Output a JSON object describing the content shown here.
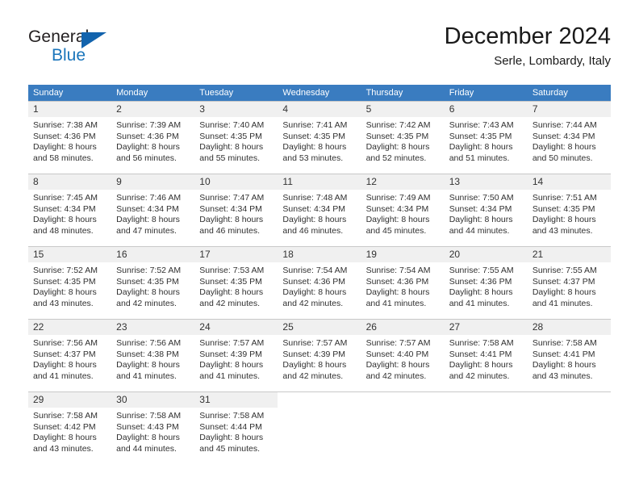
{
  "brand": {
    "name_part1": "General",
    "name_part2": "Blue",
    "triangle_color": "#1263ad",
    "blue_color": "#1a75bb"
  },
  "header": {
    "title": "December 2024",
    "subtitle": "Serle, Lombardy, Italy"
  },
  "calendar": {
    "header_bg": "#3a7cc0",
    "day_number_bg": "#f0f0f0",
    "weekdays": [
      "Sunday",
      "Monday",
      "Tuesday",
      "Wednesday",
      "Thursday",
      "Friday",
      "Saturday"
    ],
    "weeks": [
      [
        {
          "date": "1",
          "sunrise": "Sunrise: 7:38 AM",
          "sunset": "Sunset: 4:36 PM",
          "daylight_1": "Daylight: 8 hours",
          "daylight_2": "and 58 minutes."
        },
        {
          "date": "2",
          "sunrise": "Sunrise: 7:39 AM",
          "sunset": "Sunset: 4:36 PM",
          "daylight_1": "Daylight: 8 hours",
          "daylight_2": "and 56 minutes."
        },
        {
          "date": "3",
          "sunrise": "Sunrise: 7:40 AM",
          "sunset": "Sunset: 4:35 PM",
          "daylight_1": "Daylight: 8 hours",
          "daylight_2": "and 55 minutes."
        },
        {
          "date": "4",
          "sunrise": "Sunrise: 7:41 AM",
          "sunset": "Sunset: 4:35 PM",
          "daylight_1": "Daylight: 8 hours",
          "daylight_2": "and 53 minutes."
        },
        {
          "date": "5",
          "sunrise": "Sunrise: 7:42 AM",
          "sunset": "Sunset: 4:35 PM",
          "daylight_1": "Daylight: 8 hours",
          "daylight_2": "and 52 minutes."
        },
        {
          "date": "6",
          "sunrise": "Sunrise: 7:43 AM",
          "sunset": "Sunset: 4:35 PM",
          "daylight_1": "Daylight: 8 hours",
          "daylight_2": "and 51 minutes."
        },
        {
          "date": "7",
          "sunrise": "Sunrise: 7:44 AM",
          "sunset": "Sunset: 4:34 PM",
          "daylight_1": "Daylight: 8 hours",
          "daylight_2": "and 50 minutes."
        }
      ],
      [
        {
          "date": "8",
          "sunrise": "Sunrise: 7:45 AM",
          "sunset": "Sunset: 4:34 PM",
          "daylight_1": "Daylight: 8 hours",
          "daylight_2": "and 48 minutes."
        },
        {
          "date": "9",
          "sunrise": "Sunrise: 7:46 AM",
          "sunset": "Sunset: 4:34 PM",
          "daylight_1": "Daylight: 8 hours",
          "daylight_2": "and 47 minutes."
        },
        {
          "date": "10",
          "sunrise": "Sunrise: 7:47 AM",
          "sunset": "Sunset: 4:34 PM",
          "daylight_1": "Daylight: 8 hours",
          "daylight_2": "and 46 minutes."
        },
        {
          "date": "11",
          "sunrise": "Sunrise: 7:48 AM",
          "sunset": "Sunset: 4:34 PM",
          "daylight_1": "Daylight: 8 hours",
          "daylight_2": "and 46 minutes."
        },
        {
          "date": "12",
          "sunrise": "Sunrise: 7:49 AM",
          "sunset": "Sunset: 4:34 PM",
          "daylight_1": "Daylight: 8 hours",
          "daylight_2": "and 45 minutes."
        },
        {
          "date": "13",
          "sunrise": "Sunrise: 7:50 AM",
          "sunset": "Sunset: 4:34 PM",
          "daylight_1": "Daylight: 8 hours",
          "daylight_2": "and 44 minutes."
        },
        {
          "date": "14",
          "sunrise": "Sunrise: 7:51 AM",
          "sunset": "Sunset: 4:35 PM",
          "daylight_1": "Daylight: 8 hours",
          "daylight_2": "and 43 minutes."
        }
      ],
      [
        {
          "date": "15",
          "sunrise": "Sunrise: 7:52 AM",
          "sunset": "Sunset: 4:35 PM",
          "daylight_1": "Daylight: 8 hours",
          "daylight_2": "and 43 minutes."
        },
        {
          "date": "16",
          "sunrise": "Sunrise: 7:52 AM",
          "sunset": "Sunset: 4:35 PM",
          "daylight_1": "Daylight: 8 hours",
          "daylight_2": "and 42 minutes."
        },
        {
          "date": "17",
          "sunrise": "Sunrise: 7:53 AM",
          "sunset": "Sunset: 4:35 PM",
          "daylight_1": "Daylight: 8 hours",
          "daylight_2": "and 42 minutes."
        },
        {
          "date": "18",
          "sunrise": "Sunrise: 7:54 AM",
          "sunset": "Sunset: 4:36 PM",
          "daylight_1": "Daylight: 8 hours",
          "daylight_2": "and 42 minutes."
        },
        {
          "date": "19",
          "sunrise": "Sunrise: 7:54 AM",
          "sunset": "Sunset: 4:36 PM",
          "daylight_1": "Daylight: 8 hours",
          "daylight_2": "and 41 minutes."
        },
        {
          "date": "20",
          "sunrise": "Sunrise: 7:55 AM",
          "sunset": "Sunset: 4:36 PM",
          "daylight_1": "Daylight: 8 hours",
          "daylight_2": "and 41 minutes."
        },
        {
          "date": "21",
          "sunrise": "Sunrise: 7:55 AM",
          "sunset": "Sunset: 4:37 PM",
          "daylight_1": "Daylight: 8 hours",
          "daylight_2": "and 41 minutes."
        }
      ],
      [
        {
          "date": "22",
          "sunrise": "Sunrise: 7:56 AM",
          "sunset": "Sunset: 4:37 PM",
          "daylight_1": "Daylight: 8 hours",
          "daylight_2": "and 41 minutes."
        },
        {
          "date": "23",
          "sunrise": "Sunrise: 7:56 AM",
          "sunset": "Sunset: 4:38 PM",
          "daylight_1": "Daylight: 8 hours",
          "daylight_2": "and 41 minutes."
        },
        {
          "date": "24",
          "sunrise": "Sunrise: 7:57 AM",
          "sunset": "Sunset: 4:39 PM",
          "daylight_1": "Daylight: 8 hours",
          "daylight_2": "and 41 minutes."
        },
        {
          "date": "25",
          "sunrise": "Sunrise: 7:57 AM",
          "sunset": "Sunset: 4:39 PM",
          "daylight_1": "Daylight: 8 hours",
          "daylight_2": "and 42 minutes."
        },
        {
          "date": "26",
          "sunrise": "Sunrise: 7:57 AM",
          "sunset": "Sunset: 4:40 PM",
          "daylight_1": "Daylight: 8 hours",
          "daylight_2": "and 42 minutes."
        },
        {
          "date": "27",
          "sunrise": "Sunrise: 7:58 AM",
          "sunset": "Sunset: 4:41 PM",
          "daylight_1": "Daylight: 8 hours",
          "daylight_2": "and 42 minutes."
        },
        {
          "date": "28",
          "sunrise": "Sunrise: 7:58 AM",
          "sunset": "Sunset: 4:41 PM",
          "daylight_1": "Daylight: 8 hours",
          "daylight_2": "and 43 minutes."
        }
      ],
      [
        {
          "date": "29",
          "sunrise": "Sunrise: 7:58 AM",
          "sunset": "Sunset: 4:42 PM",
          "daylight_1": "Daylight: 8 hours",
          "daylight_2": "and 43 minutes."
        },
        {
          "date": "30",
          "sunrise": "Sunrise: 7:58 AM",
          "sunset": "Sunset: 4:43 PM",
          "daylight_1": "Daylight: 8 hours",
          "daylight_2": "and 44 minutes."
        },
        {
          "date": "31",
          "sunrise": "Sunrise: 7:58 AM",
          "sunset": "Sunset: 4:44 PM",
          "daylight_1": "Daylight: 8 hours",
          "daylight_2": "and 45 minutes."
        },
        {
          "date": "",
          "sunrise": "",
          "sunset": "",
          "daylight_1": "",
          "daylight_2": ""
        },
        {
          "date": "",
          "sunrise": "",
          "sunset": "",
          "daylight_1": "",
          "daylight_2": ""
        },
        {
          "date": "",
          "sunrise": "",
          "sunset": "",
          "daylight_1": "",
          "daylight_2": ""
        },
        {
          "date": "",
          "sunrise": "",
          "sunset": "",
          "daylight_1": "",
          "daylight_2": ""
        }
      ]
    ]
  }
}
